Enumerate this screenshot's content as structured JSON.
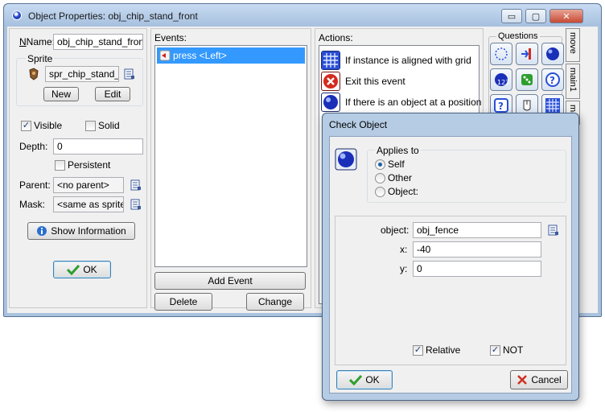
{
  "main_window": {
    "title": "Object Properties: obj_chip_stand_front",
    "controls": {
      "minimize": "▭",
      "maximize": "▢",
      "close": "✕"
    }
  },
  "props": {
    "name_label": "Name:",
    "name_value": "obj_chip_stand_front",
    "sprite_group": "Sprite",
    "sprite_value": "spr_chip_stand_fr",
    "new_label": "New",
    "edit_label": "Edit",
    "visible_label": "Visible",
    "visible_checked": true,
    "solid_label": "Solid",
    "solid_checked": false,
    "depth_label": "Depth:",
    "depth_value": "0",
    "persistent_label": "Persistent",
    "persistent_checked": false,
    "parent_label": "Parent:",
    "parent_value": "<no parent>",
    "mask_label": "Mask:",
    "mask_value": "<same as sprite>",
    "show_info_label": "Show Information",
    "ok_label": "OK"
  },
  "events": {
    "header": "Events:",
    "items": [
      "press <Left>"
    ],
    "add_event_label": "Add Event",
    "delete_label": "Delete",
    "change_label": "Change"
  },
  "actions": {
    "header": "Actions:",
    "items": [
      {
        "label": "If instance is aligned with grid",
        "icon": "grid-icon"
      },
      {
        "label": "Exit this event",
        "icon": "exit-icon"
      },
      {
        "label": "If there is an object at a position",
        "icon": "object-ball-icon"
      }
    ]
  },
  "library": {
    "group_title": "Questions",
    "tabs": [
      "move",
      "main1",
      "ma"
    ]
  },
  "dialog": {
    "title": "Check Object",
    "applies_to_label": "Applies to",
    "self_label": "Self",
    "other_label": "Other",
    "object_label": "Object:",
    "selected_applies": "Self",
    "object_field_label": "object:",
    "object_field_value": "obj_fence",
    "x_label": "x:",
    "x_value": "-40",
    "y_label": "y:",
    "y_value": "0",
    "relative_label": "Relative",
    "relative_checked": true,
    "not_label": "NOT",
    "not_checked": true,
    "ok_label": "OK",
    "cancel_label": "Cancel"
  },
  "colors": {
    "selection": "#3399ff",
    "title_bar": "#a9c2de",
    "ok_check": "#2e9e2e",
    "cancel_x": "#d03020"
  }
}
